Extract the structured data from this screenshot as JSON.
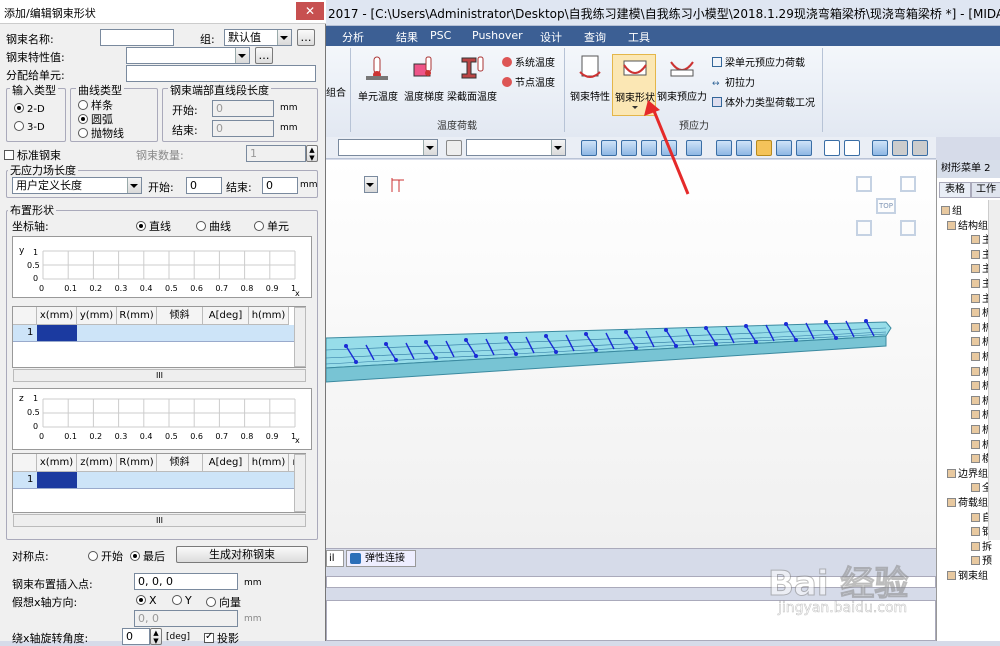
{
  "window": {
    "title": "2017 - [C:\\Users\\Administrator\\Desktop\\自我练习建模\\自我练习小模型\\2018.1.29现浇弯箱梁桥\\现浇弯箱梁桥 *] - [MIDAS/Civil]"
  },
  "menu": [
    "分析",
    "结果",
    "PSC",
    "Pushover",
    "设计",
    "查询",
    "工具"
  ],
  "ribbon": {
    "partial_left": "组合",
    "temp_group": {
      "label": "温度荷载",
      "items": [
        "单元温度",
        "温度梯度",
        "梁截面温度"
      ],
      "small_items": [
        "系统温度",
        "节点温度"
      ]
    },
    "prestress_group": {
      "label": "预应力",
      "items": [
        "钢束特性",
        "钢束形状",
        "钢束预应力"
      ],
      "small_items": [
        "梁单元预应力荷载",
        "初拉力",
        "体外力类型荷载工况"
      ]
    }
  },
  "viewport": {
    "view_label": "TOP",
    "tab_partial": "il",
    "tab_label": "弹性连接"
  },
  "tree_panel": {
    "title": "树形菜单 2",
    "tabs": [
      "表格",
      "工作"
    ],
    "root": "组",
    "n1": "结构组",
    "c1": [
      "主",
      "主",
      "主",
      "主",
      "主",
      "析",
      "析",
      "析",
      "析",
      "析",
      "析",
      "析",
      "析",
      "析",
      "析",
      "横"
    ],
    "n2": "边界组",
    "c2": [
      "全"
    ],
    "n3": "荷载组",
    "c3": [
      "自",
      "钢",
      "拆",
      "预"
    ],
    "n4": "钢束组"
  },
  "dialog": {
    "title": "添加/编辑钢束形状",
    "name_label": "钢束名称:",
    "name_value": "",
    "group_label": "组:",
    "group_value": "默认值",
    "prop_label": "钢束特性值:",
    "prop_value": "",
    "assign_label": "分配给单元:",
    "assign_value": "",
    "input_type": {
      "label": "输入类型",
      "opt1": "2-D",
      "opt2": "3-D"
    },
    "curve_type": {
      "label": "曲线类型",
      "opt1": "样条",
      "opt2": "圆弧",
      "opt3": "抛物线"
    },
    "end_straight": {
      "label": "钢束端部直线段长度",
      "start_label": "开始:",
      "start_value": "0",
      "end_label": "结束:",
      "end_value": "0",
      "unit": "mm"
    },
    "std_label": "标准钢束",
    "count_label": "钢束数量:",
    "count_value": "1",
    "free_len_label": "无应力场长度",
    "free_len_select": "用户定义长度",
    "fl_start_label": "开始:",
    "fl_start_value": "0",
    "fl_end_label": "结束:",
    "fl_end_value": "0",
    "fl_unit": "mm",
    "layout_label": "布置形状",
    "coord_label": "坐标轴:",
    "coord_opts": [
      "直线",
      "曲线",
      "单元"
    ],
    "plot1": {
      "axis_label": "y",
      "xlabel": "x",
      "yticks": [
        "1",
        "0.5",
        "0"
      ],
      "xticks": [
        "0",
        "0.1",
        "0.2",
        "0.3",
        "0.4",
        "0.5",
        "0.6",
        "0.7",
        "0.8",
        "0.9",
        "1"
      ]
    },
    "table1": {
      "headers": [
        "x(mm)",
        "y(mm)",
        "R(mm)",
        "倾斜",
        "A[deg]",
        "h(mm)"
      ],
      "row": "1"
    },
    "plot2": {
      "axis_label": "z",
      "xlabel": "x",
      "yticks": [
        "1",
        "0.5",
        "0"
      ],
      "xticks": [
        "0",
        "0.1",
        "0.2",
        "0.3",
        "0.4",
        "0.5",
        "0.6",
        "0.7",
        "0.8",
        "0.9",
        "1"
      ]
    },
    "table2": {
      "headers": [
        "x(mm)",
        "z(mm)",
        "R(mm)",
        "倾斜",
        "A[deg]",
        "h(mm)",
        "r"
      ],
      "row": "1"
    },
    "hscroll": "III",
    "sym_label": "对称点:",
    "sym_opt1": "开始",
    "sym_opt2": "最后",
    "gen_button": "生成对称钢束",
    "insert_label": "钢束布置插入点:",
    "insert_value": "0, 0, 0",
    "insert_unit": "mm",
    "xaxis_label": "假想x轴方向:",
    "xaxis_opts": [
      "X",
      "Y",
      "向量"
    ],
    "xaxis_value": "0, 0",
    "xaxis_unit": "mm",
    "rot_label": "绕x轴旋转角度:",
    "rot_value": "0",
    "rot_unit": "[deg]",
    "proj_label": "投影"
  },
  "watermark": {
    "text": "Bai 经验",
    "url": "jingyan.baidu.com"
  }
}
